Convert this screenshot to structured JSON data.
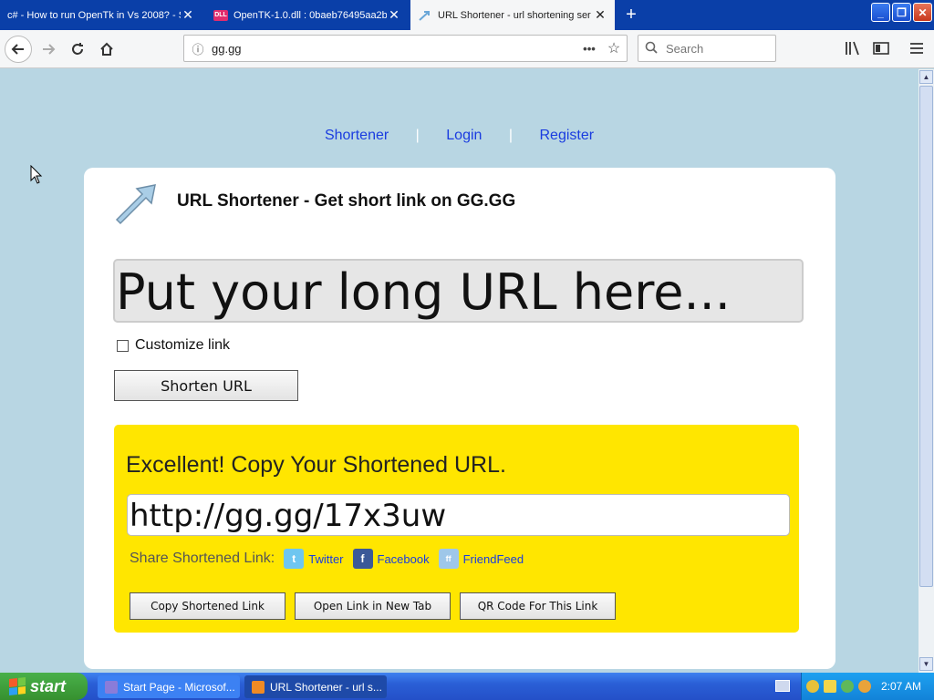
{
  "browser": {
    "tabs": [
      {
        "title": "c# - How to run OpenTk in Vs 2008? - S",
        "close": "✕"
      },
      {
        "title": "OpenTK-1.0.dll : 0baeb76495aa2b",
        "favicon": "DLL",
        "close": "✕"
      },
      {
        "title": "URL Shortener - url shortening ser",
        "close": "✕"
      }
    ],
    "new_tab": "+",
    "window_buttons": {
      "minimize": "_",
      "restore": "❐",
      "close": "✕"
    },
    "url": "gg.gg",
    "page_actions": "•••",
    "search_placeholder": "Search"
  },
  "nav": {
    "links": [
      "Shortener",
      "Login",
      "Register"
    ],
    "separator": "|"
  },
  "page": {
    "heading": "URL Shortener - Get short link on GG.GG",
    "long_url_placeholder": "Put your long URL here...",
    "customize_label": "Customize link",
    "shorten_button": "Shorten URL",
    "result": {
      "title": "Excellent! Copy Your Shortened URL.",
      "short_url": "http://gg.gg/17x3uw",
      "share_label": "Share Shortened Link:",
      "share_links": [
        "Twitter",
        "Facebook",
        "FriendFeed"
      ],
      "share_icon_text": {
        "twitter": "t",
        "facebook": "f",
        "friendfeed": "ff"
      },
      "buttons": [
        "Copy Shortened Link",
        "Open Link in New Tab",
        "QR Code For This Link"
      ]
    }
  },
  "taskbar": {
    "start": "start",
    "items": [
      "Start Page - Microsof...",
      "URL Shortener - url s..."
    ],
    "clock": "2:07 AM"
  }
}
